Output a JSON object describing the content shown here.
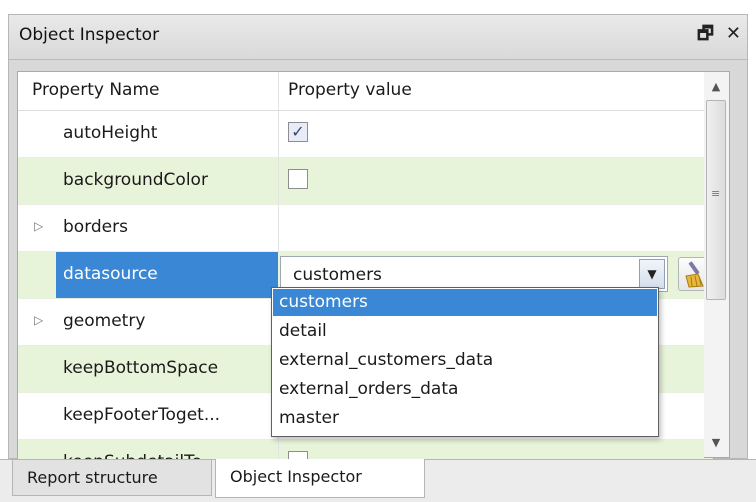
{
  "panel": {
    "title": "Object Inspector",
    "icons": {
      "float": "restore-window-icon",
      "close": "close-icon"
    },
    "float_glyph": "🗗",
    "close_glyph": "✕"
  },
  "grid": {
    "headers": {
      "name": "Property Name",
      "value": "Property value"
    },
    "rows": [
      {
        "name": "autoHeight",
        "value_type": "checkbox",
        "checked": true,
        "check_glyph": "✓"
      },
      {
        "name": "backgroundColor",
        "value_type": "color-box",
        "checked": false
      },
      {
        "name": "borders",
        "value_type": "none",
        "expander": "▷"
      },
      {
        "name": "datasource",
        "value_type": "combo",
        "value": "customers",
        "selected": true
      },
      {
        "name": "geometry",
        "value_type": "none",
        "expander": "▷"
      },
      {
        "name": "keepBottomSpace",
        "value_type": "none"
      },
      {
        "name": "keepFooterTogether",
        "display_name": "keepFooterToget...",
        "value_type": "none"
      },
      {
        "name": "keepSubdetailTo",
        "display_name": "keepSubdetailTo",
        "value_type": "checkbox",
        "checked": false
      }
    ]
  },
  "combo": {
    "arrow_glyph": "▼",
    "clear_icon": "broom-icon"
  },
  "dropdown": {
    "options": [
      "customers",
      "detail",
      "external_customers_data",
      "external_orders_data",
      "master"
    ],
    "selected_index": 0
  },
  "scrollbar": {
    "up_glyph": "▲",
    "down_glyph": "▼",
    "grip": "≡"
  },
  "tabs": [
    {
      "label": "Report structure",
      "active": false
    },
    {
      "label": "Object Inspector",
      "active": true
    }
  ],
  "colors": {
    "accent": "#3a88d5",
    "alt_row": "#e8f4da",
    "title_bg": "#dedede"
  }
}
